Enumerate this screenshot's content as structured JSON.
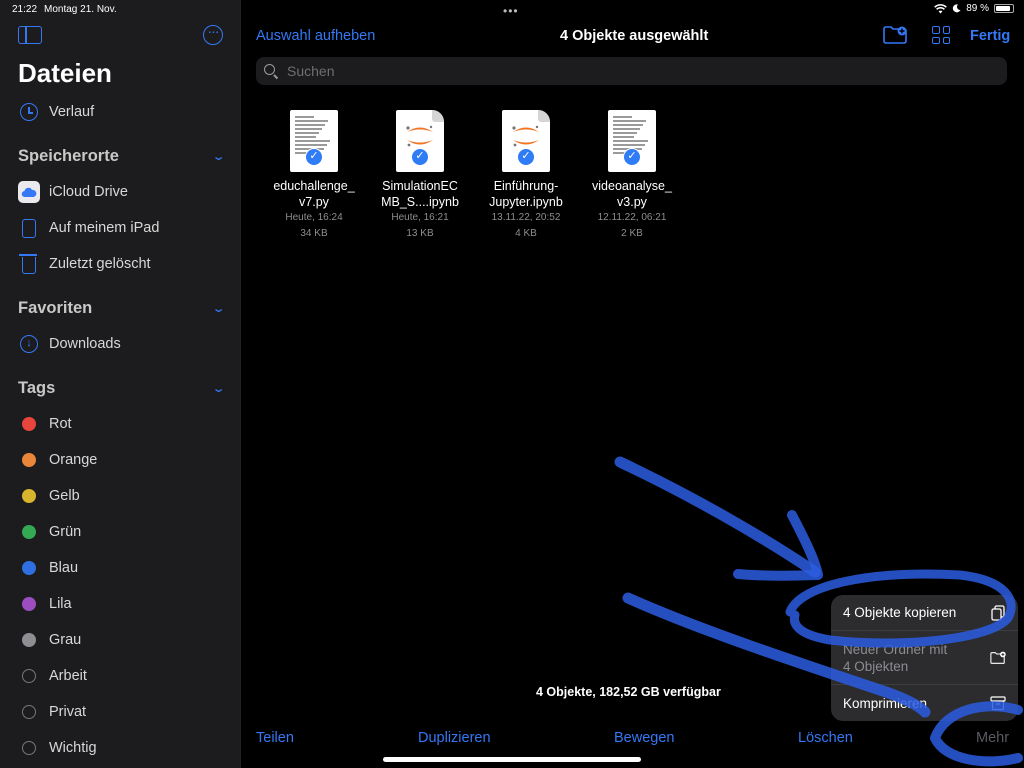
{
  "status": {
    "time": "21:22",
    "date": "Montag 21. Nov.",
    "battery": "89 %",
    "battery_level": 0.89
  },
  "sidebar": {
    "title": "Dateien",
    "recent": "Verlauf",
    "locations_header": "Speicherorte",
    "locations": [
      "iCloud Drive",
      "Auf meinem iPad",
      "Zuletzt gelöscht"
    ],
    "favorites_header": "Favoriten",
    "favorites": [
      "Downloads"
    ],
    "tags_header": "Tags",
    "tags": [
      {
        "label": "Rot",
        "color": "#e8453c"
      },
      {
        "label": "Orange",
        "color": "#e8873a"
      },
      {
        "label": "Gelb",
        "color": "#d8b42f"
      },
      {
        "label": "Grün",
        "color": "#34a853"
      },
      {
        "label": "Blau",
        "color": "#2f6fe0"
      },
      {
        "label": "Lila",
        "color": "#9c4ec0"
      },
      {
        "label": "Grau",
        "color": "#8e8e93"
      },
      {
        "label": "Arbeit",
        "color": ""
      },
      {
        "label": "Privat",
        "color": ""
      },
      {
        "label": "Wichtig",
        "color": ""
      }
    ]
  },
  "header": {
    "deselect": "Auswahl aufheben",
    "title": "4 Objekte ausgewählt",
    "done": "Fertig"
  },
  "search": {
    "placeholder": "Suchen"
  },
  "files": [
    {
      "name": "educhallenge_\nv7.py",
      "date": "Heute, 16:24",
      "size": "34 KB",
      "kind": "doc"
    },
    {
      "name": "SimulationEC\nMB_S....ipynb",
      "date": "Heute, 16:21",
      "size": "13 KB",
      "kind": "notebook"
    },
    {
      "name": "Einführung-\nJupyter.ipynb",
      "date": "13.11.22, 20:52",
      "size": "4 KB",
      "kind": "notebook"
    },
    {
      "name": "videoanalyse_\nv3.py",
      "date": "12.11.22, 06:21",
      "size": "2 KB",
      "kind": "doc"
    }
  ],
  "footer": {
    "info": "4 Objekte, 182,52 GB verfügbar"
  },
  "toolbar": {
    "share": "Teilen",
    "duplicate": "Duplizieren",
    "move": "Bewegen",
    "delete": "Löschen",
    "more": "Mehr"
  },
  "menu": {
    "copy": "4 Objekte kopieren",
    "new_folder_line1": "Neuer Ordner mit",
    "new_folder_line2": "4 Objekten",
    "compress": "Komprimieren"
  },
  "colors": {
    "accent": "#3478f6",
    "annotation": "#2b5de0"
  }
}
